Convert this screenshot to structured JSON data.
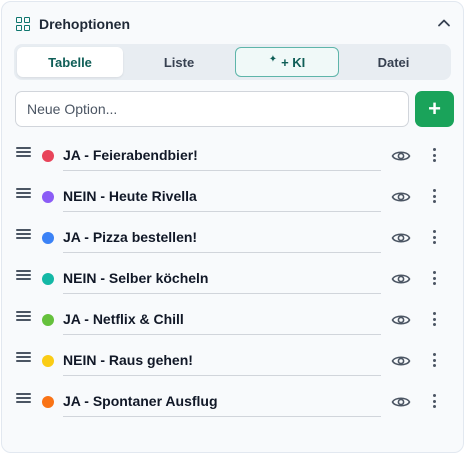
{
  "header": {
    "title": "Drehoptionen"
  },
  "tabs": [
    {
      "label": "Tabelle",
      "active": true
    },
    {
      "label": "Liste",
      "active": false
    },
    {
      "label": "+ KI",
      "active": false
    },
    {
      "label": "Datei",
      "active": false
    }
  ],
  "input": {
    "placeholder": "Neue Option...",
    "value": ""
  },
  "add_button": {
    "label": "+"
  },
  "items": [
    {
      "label": "JA - Feierabendbier!",
      "color": "#e8445a"
    },
    {
      "label": "NEIN - Heute Rivella",
      "color": "#8b5cf6"
    },
    {
      "label": "JA - Pizza bestellen!",
      "color": "#3b82f6"
    },
    {
      "label": "NEIN - Selber köcheln",
      "color": "#14b8a6"
    },
    {
      "label": "JA - Netflix & Chill",
      "color": "#65c13c"
    },
    {
      "label": "NEIN - Raus gehen!",
      "color": "#facc15"
    },
    {
      "label": "JA - Spontaner Ausflug",
      "color": "#f97316"
    }
  ],
  "icons": {
    "header": "grid-icon",
    "collapse": "chevron-up-icon",
    "drag": "drag-handle-icon",
    "visibility": "eye-icon",
    "menu": "more-vertical-icon",
    "ki": "sparkle-icon"
  },
  "colors": {
    "accent": "#0f766e",
    "add_button": "#1aa35a"
  }
}
